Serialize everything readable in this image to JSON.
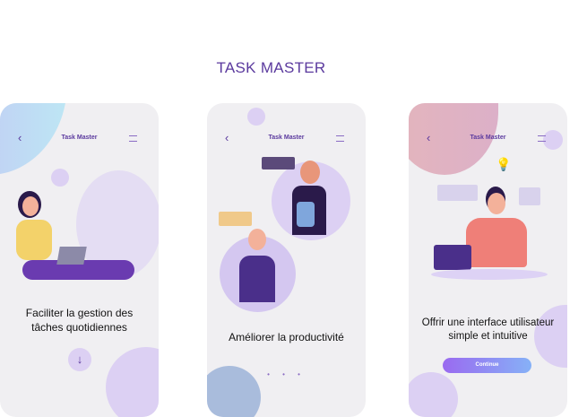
{
  "title": "TASK MASTER",
  "screens": [
    {
      "header": "Task Master",
      "caption_line1": "Faciliter la gestion des",
      "caption_line2": "tâches quotidiennes",
      "down_icon": "↓"
    },
    {
      "header": "Task Master",
      "caption_line1": "Améliorer la productivité",
      "dots": "• • •"
    },
    {
      "header": "Task Master",
      "caption_line1": "Offrir une interface utilisateur",
      "caption_line2": "simple et intuitive",
      "button": "Continue"
    }
  ],
  "icons": {
    "back": "‹",
    "menu": "menu-icon"
  },
  "colors": {
    "brand": "#5b3a9e",
    "accent": "#9a6af0"
  }
}
